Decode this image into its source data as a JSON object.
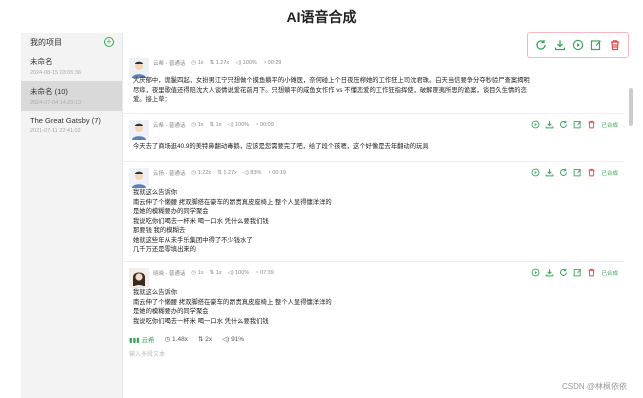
{
  "app": {
    "title": "AI语音合成"
  },
  "sidebar": {
    "header": "我的项目",
    "add_symbol": "+",
    "projects": [
      {
        "name": "未命名",
        "date": "2024-08-15 03:05:36",
        "active": false
      },
      {
        "name": "未命名 (10)",
        "date": "2024-07-04 14:20:13",
        "active": true
      },
      {
        "name": "The Great Gatsby (7)",
        "date": "2021-07-11 22:41:02",
        "active": false
      }
    ]
  },
  "toolbar": {
    "icons": [
      "refresh-icon",
      "download-icon",
      "play-icon",
      "edit-icon",
      "delete-icon"
    ]
  },
  "cards": [
    {
      "voice": "云希 - 普通话",
      "speed": "1x",
      "pitch": "1.27x",
      "volume": "100%",
      "duration": "00:29",
      "status": "",
      "lines": [
        "大庆郁中，诡鬣四起，女扮男江宁只想做个摸鱼躺平的小傩医，奈何碰上个日夜压榨她的工作狂上司沈君珠。白天当信要争分夺秒验尸查案揭明",
        "尽瘁，夜里歌值还得陪沈大人谈情说爱花前月下。只想躺平的咸鱼女作作 vs 不懂恋爱的工作狂指挥使，破解匪夷所思的诡案，谈目久生情的恋",
        "爱。接上草："
      ]
    },
    {
      "voice": "云希 - 普通话",
      "speed": "1x",
      "pitch": "1x",
      "volume": "100%",
      "duration": "00:09",
      "status": "已合成",
      "lines": [
        "今天去了商场逛40.9的美特鼻翻动毒鹅，应该是您需要完了吧，给了段个孩嗯，这个好像是去年翻动的玩具"
      ]
    },
    {
      "voice": "云扬 - 普通话",
      "speed": "1.22x",
      "pitch": "1.27x",
      "volume": "83%",
      "duration": "00:19",
      "status": "已合成",
      "lines": [
        "我就这么告诉你",
        "南云伸了个懒腰 拷双脚搭在豪车的昂贵真皮座椅上 整个人显得慵洋洋的",
        "是她的模糊要办的同学聚会",
        "我说吃你们喝去一杯米 喝一口水 凭什么要我们钱",
        "那要钱 我的模糊去",
        "她就这些年从未手乐集团中得了不少钱水了",
        "几千万还是零填出来的"
      ]
    },
    {
      "voice": "晓晓 - 普通话",
      "speed": "1x",
      "pitch": "1x",
      "volume": "100%",
      "duration": "07:39",
      "status": "已合成",
      "lines": [
        "我就这么告诉你",
        "南云伸了个懒腰 拷双脚搭在豪车的昂贵真皮座椅上 整个人显得慵洋洋的",
        "是她的模糊要办的同学聚会",
        "我说吃你们喝去一杯米 喝一口水 凭什么要我们钱"
      ]
    }
  ],
  "footer": {
    "voice": "云希",
    "speed": "1.48x",
    "pitch": "2x",
    "volume": "91%",
    "placeholder": "输入多段文本"
  },
  "watermark": "CSDN @林枫依依",
  "colors": {
    "accent": "#3aa85a",
    "delete": "#e04848",
    "highlight_border": "#f4b8c4"
  }
}
